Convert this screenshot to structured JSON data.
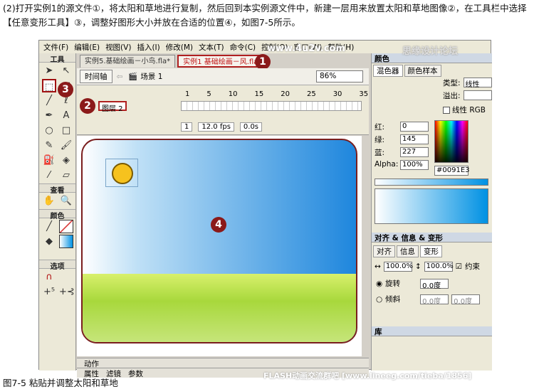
{
  "caption": "(2)打开实例1的源文件①，将太阳和草地进行复制，然后回到本实例源文件中，新建一层用来放置太阳和草地图像②，在工具栏中选择【任意变形工具】③，调整好图形大小并放在合适的位置④，如图7-5所示。",
  "figure_caption": "图7-5 粘贴并调整太阳和草地",
  "watermark_top": "www.4u2v.com",
  "watermark_bottom": "FLASH动画交流群吧 [www.lineeg.com/tieba/1856]",
  "watermark_corner": "思缘设计论坛",
  "menu": [
    "文件(F)",
    "编辑(E)",
    "视图(V)",
    "插入(I)",
    "修改(M)",
    "文本(T)",
    "命令(C)",
    "控制(O)",
    "窗口(W)",
    "帮助(H)"
  ],
  "tools": {
    "header": "工具",
    "view_label": "查看",
    "color_label": "颜色",
    "options_label": "选项"
  },
  "tabs": [
    "实例5.基础绘画－小鸟.fla*",
    "实例1 基础绘画－风.fla"
  ],
  "scene": {
    "timeline_btn": "时间轴",
    "scene_label": "场景 1",
    "zoom": "86%"
  },
  "timeline": {
    "frame_numbers": [
      "1",
      "5",
      "10",
      "15",
      "20",
      "25",
      "30",
      "35"
    ],
    "layer_name": "图层 2",
    "frame": "1",
    "fps": "12.0 fps",
    "time": "0.0s"
  },
  "badges": [
    "1",
    "2",
    "3",
    "4"
  ],
  "bottom_panels": {
    "actions": "动作",
    "properties": "属性",
    "filters": "滤镜",
    "params": "参数"
  },
  "color_panel": {
    "title": "颜色",
    "tab1": "混色器",
    "tab2": "颜色样本",
    "type_label": "类型:",
    "type_value": "线性",
    "overflow_label": "溢出:",
    "linear_rgb": "线性 RGB",
    "red_label": "红:",
    "red": "0",
    "green_label": "绿:",
    "green": "145",
    "blue_label": "蓝:",
    "blue": "227",
    "alpha_label": "Alpha:",
    "alpha": "100%",
    "hex": "#0091E3"
  },
  "transform_panel": {
    "title": "对齐 & 信息 & 变形",
    "tab_align": "对齐",
    "tab_info": "信息",
    "tab_transform": "变形",
    "width_pct": "100.0%",
    "height_pct": "100.0%",
    "constrain": "约束",
    "rotate": "旋转",
    "rotate_val": "0.0度",
    "skew": "倾斜",
    "skew_h": "0.0度",
    "skew_v": "0.0度"
  },
  "library": "库",
  "colors": {
    "accent": "#8b1a1a",
    "sky": "#0091e3",
    "grass": "#a8d83c"
  }
}
